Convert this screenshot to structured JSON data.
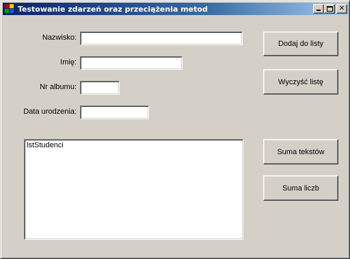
{
  "window": {
    "title": "Testowanie zdarzeń oraz przeciążenia metod",
    "close_glyph": "✕"
  },
  "form": {
    "labels": {
      "surname": "Nazwisko:",
      "first_name": "Imię:",
      "album_no": "Nr albumu:",
      "birth_date": "Data urodzenia:"
    },
    "values": {
      "surname": "",
      "first_name": "",
      "album_no": "",
      "birth_date": ""
    },
    "list": {
      "items": [
        "lstStudenci"
      ]
    }
  },
  "buttons": {
    "add_to_list": "Dodaj do listy",
    "clear_list": "Wyczyść listę",
    "sum_texts": "Suma tekstów",
    "sum_numbers": "Suma liczb"
  },
  "icons": {
    "app": "application-icon",
    "minimize": "minimize-icon",
    "maximize": "maximize-icon",
    "close": "close-icon"
  },
  "colors": {
    "face": "#d4d0c8",
    "title_active_start": "#0a246a",
    "title_active_end": "#a6caf0"
  }
}
